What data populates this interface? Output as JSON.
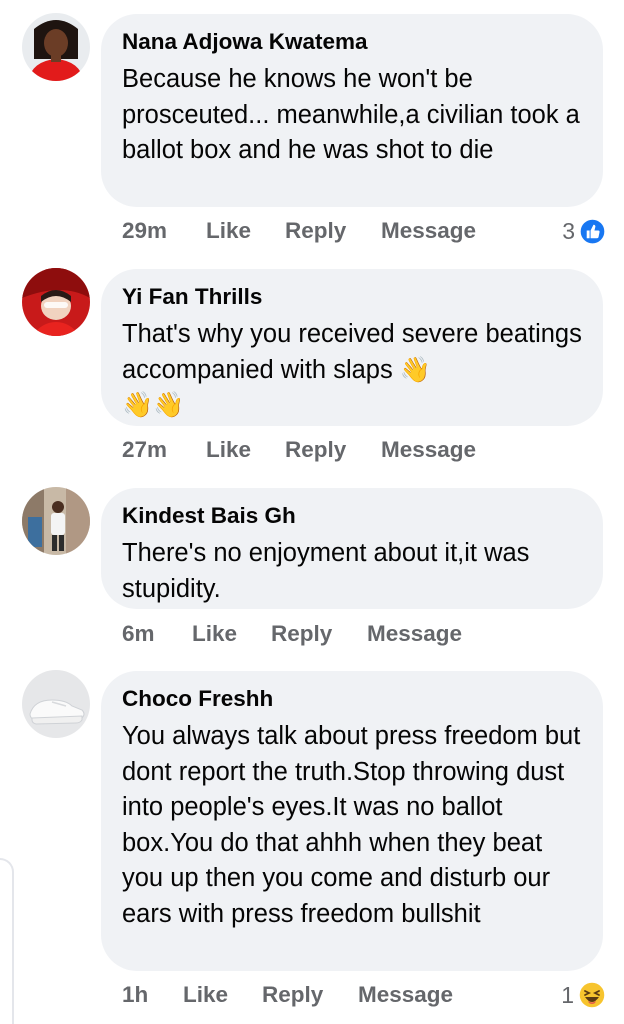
{
  "comments": [
    {
      "author": "Nana Adjowa Kwatema",
      "text": "Because he knows he won't be prosceuted... meanwhile,a civilian took a ballot box and he was shot to die",
      "time": "29m",
      "like": "Like",
      "reply": "Reply",
      "message": "Message",
      "reaction_count": "3",
      "reaction_icon": "thumbs-up-icon"
    },
    {
      "author": "Yi Fan Thrills",
      "text": "That's why you received severe beatings accompanied with slaps",
      "emoji_line1": "👋",
      "emoji_line2": "👋👋",
      "time": "27m",
      "like": "Like",
      "reply": "Reply",
      "message": "Message"
    },
    {
      "author": "Kindest Bais Gh",
      "text": "There's no enjoyment about it,it was stupidity.",
      "time": "6m",
      "like": "Like",
      "reply": "Reply",
      "message": "Message"
    },
    {
      "author": "Choco Freshh",
      "text": "You always talk about press freedom but dont report the truth.Stop throwing dust into people's eyes.It was no ballot box.You do that ahhh when they beat you up then you come and disturb our ears with press freedom bullshit",
      "time": "1h",
      "like": "Like",
      "reply": "Reply",
      "message": "Message",
      "reaction_count": "1",
      "reaction_icon": "laughing-emoji-icon"
    }
  ],
  "colors": {
    "bubble": "#f0f2f5",
    "text": "#050505",
    "secondary": "#65676b",
    "like_blue": "#1877f2"
  }
}
